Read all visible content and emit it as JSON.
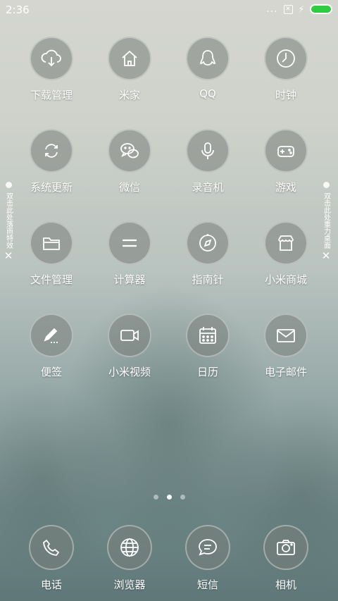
{
  "status_bar": {
    "time": "2:36",
    "dots": "...",
    "sim_icon": "sim-blocked-icon",
    "battery_color": "#2ecc40"
  },
  "apps": [
    {
      "label": "下载管理",
      "icon": "cloud-download-icon"
    },
    {
      "label": "米家",
      "icon": "home-icon"
    },
    {
      "label": "QQ",
      "icon": "penguin-icon"
    },
    {
      "label": "时钟",
      "icon": "clock-icon"
    },
    {
      "label": "系统更新",
      "icon": "refresh-icon"
    },
    {
      "label": "微信",
      "icon": "chat-bubbles-icon"
    },
    {
      "label": "录音机",
      "icon": "microphone-icon"
    },
    {
      "label": "游戏",
      "icon": "gamepad-icon"
    },
    {
      "label": "文件管理",
      "icon": "folder-icon"
    },
    {
      "label": "计算器",
      "icon": "equals-icon"
    },
    {
      "label": "指南针",
      "icon": "compass-icon"
    },
    {
      "label": "小米商城",
      "icon": "store-icon"
    },
    {
      "label": "便签",
      "icon": "pen-icon"
    },
    {
      "label": "小米视频",
      "icon": "video-camera-icon"
    },
    {
      "label": "日历",
      "icon": "calendar-icon"
    },
    {
      "label": "电子邮件",
      "icon": "mail-icon"
    }
  ],
  "side_left": {
    "text": "双击此处落雨特效"
  },
  "side_right": {
    "text": "双击此处重力桌面"
  },
  "pager": {
    "pages": 3,
    "active": 2
  },
  "dock": [
    {
      "label": "电话",
      "icon": "phone-icon"
    },
    {
      "label": "浏览器",
      "icon": "globe-icon"
    },
    {
      "label": "短信",
      "icon": "message-icon"
    },
    {
      "label": "相机",
      "icon": "camera-icon"
    }
  ]
}
